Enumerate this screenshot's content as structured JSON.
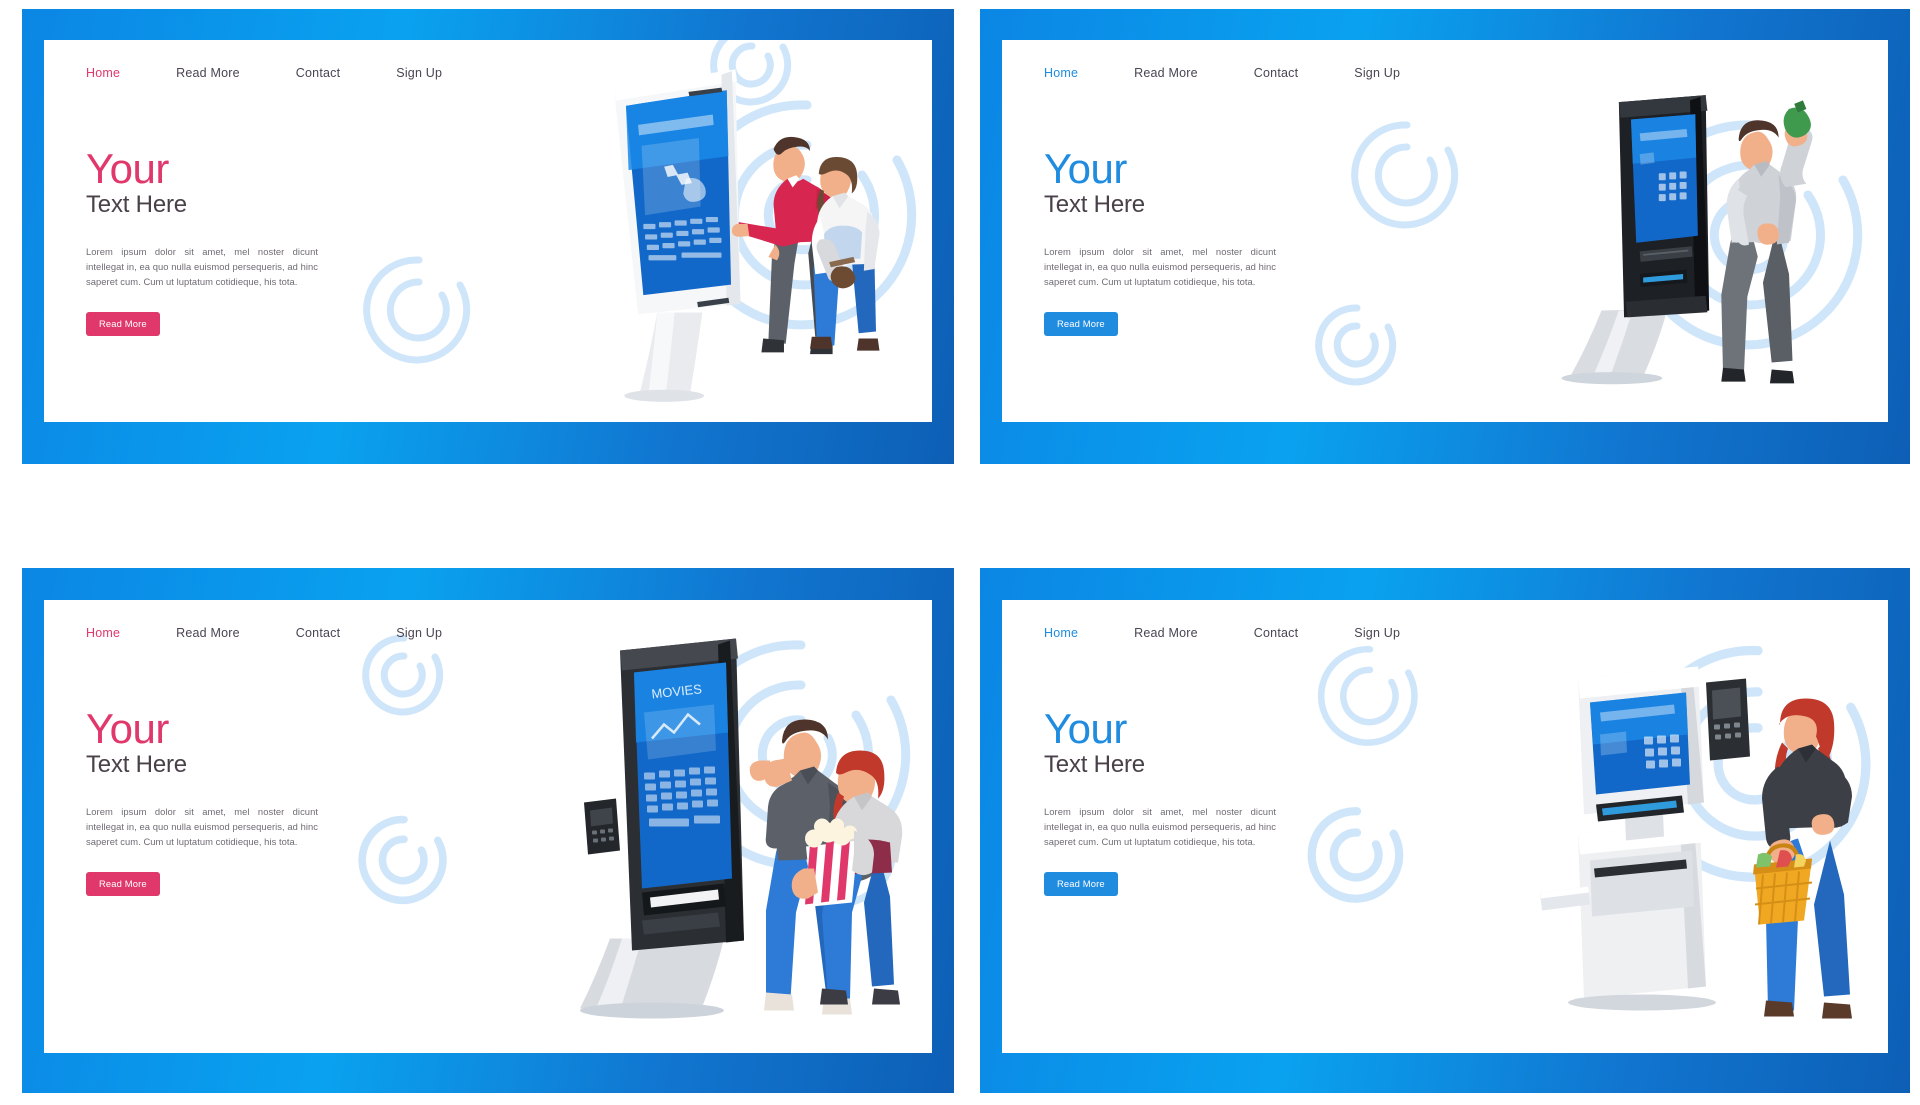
{
  "meta": {
    "layout": "2x2 grid of landing-page mockups",
    "accent_pink": "#e0386b",
    "accent_blue": "#1f8ce0",
    "frame_blue_light": "#0aa2f0",
    "frame_blue_dark": "#0d5fb5",
    "heading_dark": "#4a4049",
    "body_text": "#6f6a74",
    "decor_arc_color": "#cfe6fa"
  },
  "nav": {
    "items": [
      {
        "label": "Home"
      },
      {
        "label": "Read More"
      },
      {
        "label": "Contact"
      },
      {
        "label": "Sign Up"
      }
    ]
  },
  "hero": {
    "title_accent": "Your",
    "title_sub": "Text Here",
    "paragraph": "Lorem ipsum dolor sit amet, mel noster dicunt intellegat in, ea quo nulla euismod persequeris, ad hinc saperet cum. Cum ut luptatum cotidieque, his tota.",
    "cta_label": "Read More"
  },
  "panels": [
    {
      "id": "self-service-terminal-couple",
      "position": "top-left",
      "accent": "pink",
      "active_nav": "Home",
      "illustration": {
        "name": "white-interactive-kiosk-with-couple",
        "kiosk_color": "#f2f3f5",
        "screen_color": "#1472d2",
        "characters": [
          "man-in-red-shirt-pointing",
          "woman-in-white-coat-with-bag"
        ]
      }
    },
    {
      "id": "self-service-terminal-man",
      "position": "top-right",
      "accent": "blue",
      "active_nav": "Home",
      "illustration": {
        "name": "black-standing-kiosk-with-man",
        "kiosk_color": "#1d2024",
        "screen_color": "#1472d2",
        "characters": [
          "man-in-grey-hoodie-holding-drink"
        ]
      }
    },
    {
      "id": "cinema-ticket-kiosk-couple",
      "position": "bottom-left",
      "accent": "pink",
      "active_nav": "Home",
      "illustration": {
        "name": "movies-ticket-kiosk-with-couple",
        "kiosk_color": "#2b2f33",
        "screen_color": "#1472d2",
        "screen_label": "MOVIES",
        "characters": [
          "man-in-grey-tshirt",
          "woman-holding-popcorn-bucket"
        ]
      }
    },
    {
      "id": "self-checkout-kiosk-woman",
      "position": "bottom-right",
      "accent": "blue",
      "active_nav": "Home",
      "illustration": {
        "name": "white-self-checkout-kiosk-with-woman",
        "kiosk_color": "#eef0f2",
        "screen_color": "#1472d2",
        "characters": [
          "woman-with-red-hair-holding-shopping-basket"
        ]
      }
    }
  ]
}
